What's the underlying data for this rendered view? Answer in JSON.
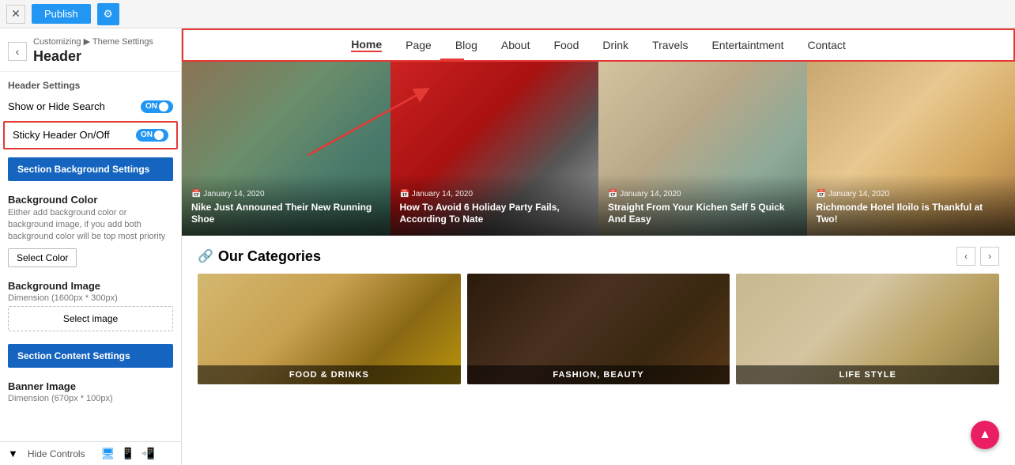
{
  "topBar": {
    "closeLabel": "✕",
    "publishLabel": "Publish",
    "gearIcon": "⚙"
  },
  "leftPanel": {
    "backArrow": "‹",
    "breadcrumb": {
      "prefix": "Customizing ▶ Theme Settings",
      "title": "Header"
    },
    "sectionLabel": "Header Settings",
    "toggles": [
      {
        "label": "Show or Hide Search",
        "value": "ON",
        "highlighted": false
      },
      {
        "label": "Sticky Header On/Off",
        "value": "ON",
        "highlighted": true
      }
    ],
    "sectionBgBtn": "Section Background Settings",
    "bgColor": {
      "title": "Background Color",
      "desc": "Either add background color or background image, if you add both background color will be top most priority",
      "btnLabel": "Select Color"
    },
    "bgImage": {
      "title": "Background Image",
      "dimension": "Dimension (1600px * 300px)",
      "btnLabel": "Select image"
    },
    "sectionContentBtn": "Section Content Settings",
    "bannerImage": {
      "title": "Banner Image",
      "dimension": "Dimension (670px * 100px)"
    }
  },
  "bottomBar": {
    "hideLabel": "Hide Controls",
    "icons": [
      "desktop",
      "tablet",
      "mobile"
    ]
  },
  "siteNav": {
    "items": [
      "Home",
      "Page",
      "Blog",
      "About",
      "Food",
      "Drink",
      "Travels",
      "Entertaintment",
      "Contact"
    ],
    "active": "Home"
  },
  "blogCards": [
    {
      "date": "📅 January 14, 2020",
      "title": "Nike Just Announed Their New Running Shoe",
      "bgClass": "bg-hiker"
    },
    {
      "date": "📅 January 14, 2020",
      "title": "How To Avoid 6 Holiday Party Fails, According To Nate",
      "bgClass": "bg-car"
    },
    {
      "date": "📅 January 14, 2020",
      "title": "Straight From Your Kichen Self 5 Quick And Easy",
      "bgClass": "bg-hat"
    },
    {
      "date": "📅 January 14, 2020",
      "title": "Richmonde Hotel Iloilo is Thankful at Two!",
      "bgClass": "bg-burger-hero"
    }
  ],
  "categories": {
    "title": "Our Categories",
    "iconSymbol": "🔗",
    "prevArrow": "‹",
    "nextArrow": "›",
    "items": [
      {
        "label": "FOOD & DRINKS",
        "bgClass": "bg-burger"
      },
      {
        "label": "FASHION, BEAUTY",
        "bgClass": "bg-barista"
      },
      {
        "label": "LIFE STYLE",
        "bgClass": "bg-lifestyle"
      }
    ]
  },
  "fab": {
    "icon": "▲"
  }
}
